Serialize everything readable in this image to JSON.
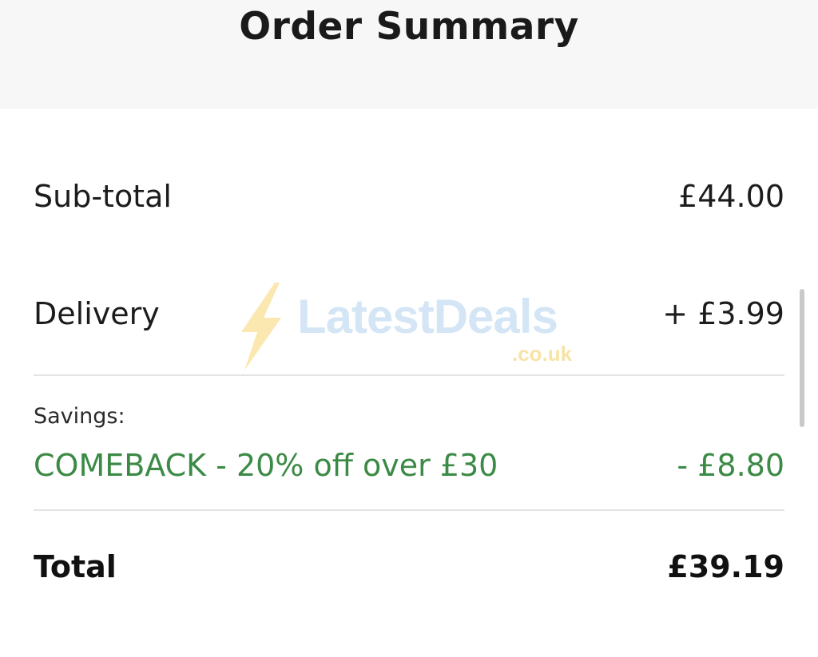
{
  "header": {
    "title": "Order Summary"
  },
  "summary": {
    "subtotal": {
      "label": "Sub-total",
      "value": "£44.00"
    },
    "delivery": {
      "label": "Delivery",
      "value": "+ £3.99"
    },
    "savings": {
      "heading": "Savings:",
      "items": [
        {
          "label": "COMEBACK - 20% off over £30",
          "value": "- £8.80"
        }
      ]
    },
    "total": {
      "label": "Total",
      "value": "£39.19"
    }
  },
  "watermark": {
    "brand": "LatestDeals",
    "domain": ".co.uk",
    "icon": "lightning-bolt-icon"
  },
  "colors": {
    "header_background": "#f7f7f7",
    "savings_green": "#3b8a45",
    "text": "#1c1c1c",
    "divider": "#e4e4e4"
  }
}
